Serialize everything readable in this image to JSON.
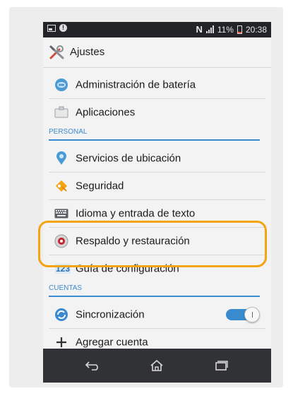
{
  "statusbar": {
    "nfc": "N",
    "battery_text": "11%",
    "time": "20:38"
  },
  "appbar": {
    "title": "Ajustes",
    "icon": "tools-icon"
  },
  "sections": {
    "personal": "PERSONAL",
    "cuentas": "CUENTAS"
  },
  "items": [
    {
      "label": "Administración de batería",
      "icon": "battery-management-icon"
    },
    {
      "label": "Aplicaciones",
      "icon": "applications-icon"
    },
    {
      "label": "Servicios de ubicación",
      "icon": "location-icon"
    },
    {
      "label": "Seguridad",
      "icon": "security-key-icon"
    },
    {
      "label": "Idioma y entrada de texto",
      "icon": "keyboard-icon"
    },
    {
      "label": "Respaldo y restauración",
      "icon": "backup-restore-icon"
    },
    {
      "label": "Guía de configuración",
      "icon": "setup-guide-icon",
      "icon_text": "123"
    },
    {
      "label": "Sincronización",
      "icon": "sync-icon",
      "toggle_on": true
    },
    {
      "label": "Agregar cuenta",
      "icon": "add-icon"
    }
  ],
  "colors": {
    "accent": "#3a8ad0",
    "highlight": "#f2a413",
    "statusbar": "#222428",
    "navbar": "#303236"
  },
  "navbar": {
    "buttons": [
      "back-icon",
      "home-icon",
      "recent-apps-icon"
    ]
  }
}
